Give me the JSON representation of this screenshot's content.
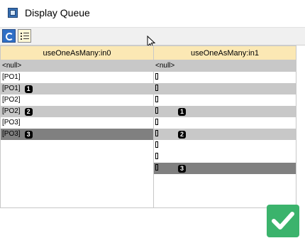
{
  "window": {
    "title": "Display Queue"
  },
  "toolbar": {
    "buttons": [
      {
        "name": "refresh",
        "icon": "refresh-icon"
      },
      {
        "name": "list",
        "icon": "list-icon"
      }
    ]
  },
  "columns": [
    {
      "label": "useOneAsMany:in0"
    },
    {
      "label": "useOneAsMany:in1"
    }
  ],
  "rows": [
    {
      "c0": "<null>",
      "c0_badge": "",
      "c1": "<null>",
      "c1_rect": false,
      "c1_badge": "",
      "bg": "#c8c8c8"
    },
    {
      "c0": "[PO1]",
      "c0_badge": "",
      "c1": "",
      "c1_rect": true,
      "c1_badge": "",
      "bg": "#ffffff"
    },
    {
      "c0": "[PO1]",
      "c0_badge": "1",
      "c1": "",
      "c1_rect": true,
      "c1_badge": "",
      "bg": "#c8c8c8"
    },
    {
      "c0": "[PO2]",
      "c0_badge": "",
      "c1": "",
      "c1_rect": true,
      "c1_badge": "",
      "bg": "#ffffff"
    },
    {
      "c0": "[PO2]",
      "c0_badge": "2",
      "c1": "",
      "c1_rect": true,
      "c1_badge": "1",
      "bg": "#c8c8c8"
    },
    {
      "c0": "[PO3]",
      "c0_badge": "",
      "c1": "",
      "c1_rect": true,
      "c1_badge": "",
      "bg": "#ffffff"
    },
    {
      "c0": "[PO3]",
      "c0_badge": "3",
      "c1": "",
      "c1_rect": true,
      "c1_badge": "2",
      "bg": "#808080",
      "c1bg": "#c8c8c8"
    },
    {
      "c0": "",
      "c0_badge": "",
      "c1": "",
      "c1_rect": true,
      "c1_badge": "",
      "bg": "#ffffff"
    },
    {
      "c0": "",
      "c0_badge": "",
      "c1": "",
      "c1_rect": true,
      "c1_badge": "",
      "bg": "#ffffff"
    },
    {
      "c0": "",
      "c0_badge": "",
      "c1": "",
      "c1_rect": true,
      "c1_badge": "3",
      "bg": "#ffffff",
      "c1bg": "#808080"
    },
    {
      "c0": "",
      "c0_badge": "",
      "c1": "",
      "c1_rect": false,
      "c1_badge": "",
      "bg": "#ffffff"
    },
    {
      "c0": "",
      "c0_badge": "",
      "c1": "",
      "c1_rect": false,
      "c1_badge": "",
      "bg": "#ffffff"
    },
    {
      "c0": "",
      "c0_badge": "",
      "c1": "",
      "c1_rect": false,
      "c1_badge": "",
      "bg": "#ffffff"
    }
  ],
  "ok_button": {
    "icon": "checkmark-icon",
    "color": "#3bb36c"
  }
}
